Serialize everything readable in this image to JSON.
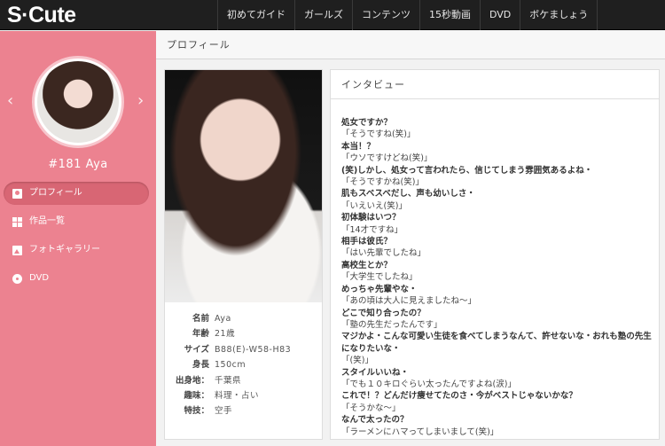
{
  "header": {
    "logo": "S·Cute",
    "nav": [
      "初めてガイド",
      "ガールズ",
      "コンテンツ",
      "15秒動画",
      "DVD",
      "ボケましょう"
    ]
  },
  "sidebar": {
    "arrow_left": "‹",
    "arrow_right": "›",
    "member_name": "#181 Aya",
    "menu": [
      {
        "label": "プロフィール",
        "icon": "profile-icon"
      },
      {
        "label": "作品一覧",
        "icon": "grid-icon"
      },
      {
        "label": "フォトギャラリー",
        "icon": "photo-icon"
      },
      {
        "label": "DVD",
        "icon": "disc-icon"
      }
    ]
  },
  "main": {
    "page_title": "プロフィール",
    "profile": {
      "rows": [
        {
          "label": "名前",
          "value": "Aya"
        },
        {
          "label": "年齢",
          "value": "21歳"
        },
        {
          "label": "サイズ",
          "value": "B88(E)-W58-H83"
        },
        {
          "label": "身長",
          "value": "150cm"
        },
        {
          "label": "出身地：",
          "value": "千葉県"
        },
        {
          "label": "趣味：",
          "value": "料理・占い"
        },
        {
          "label": "特技：",
          "value": "空手"
        }
      ]
    },
    "interview": {
      "title": "インタビュー",
      "lines": [
        {
          "q": true,
          "text": "処女ですか？"
        },
        {
          "q": false,
          "text": "「そうですね(笑)」"
        },
        {
          "q": true,
          "text": "本当！？"
        },
        {
          "q": false,
          "text": "「ウソですけどね(笑)」"
        },
        {
          "q": true,
          "text": "(笑)しかし、処女って言われたら、信じてしまう雰囲気あるよね・"
        },
        {
          "q": false,
          "text": "「そうですかね(笑)」"
        },
        {
          "q": true,
          "text": "肌もスベスベだし、声も幼いしさ・"
        },
        {
          "q": false,
          "text": "「いえいえ(笑)」"
        },
        {
          "q": true,
          "text": "初体験はいつ？"
        },
        {
          "q": false,
          "text": "「14才ですね」"
        },
        {
          "q": true,
          "text": "相手は彼氏？"
        },
        {
          "q": false,
          "text": "「はい先輩でしたね」"
        },
        {
          "q": true,
          "text": "高校生とか？"
        },
        {
          "q": false,
          "text": "「大学生でしたね」"
        },
        {
          "q": true,
          "text": "めっちゃ先輩やな・"
        },
        {
          "q": false,
          "text": "「あの頃は大人に見えましたね〜」"
        },
        {
          "q": true,
          "text": "どこで知り合ったの？"
        },
        {
          "q": false,
          "text": "「塾の先生だったんです」"
        },
        {
          "q": true,
          "wrap": true,
          "text": "マジかよ・こんな可愛い生徒を食べてしまうなんて、許せないな・おれも塾の先生になりたいな・"
        },
        {
          "q": false,
          "text": "「(笑)」"
        },
        {
          "q": true,
          "text": "スタイルいいね・"
        },
        {
          "q": false,
          "text": "「でも１０キロぐらい太ったんですよね(涙)」"
        },
        {
          "q": true,
          "text": "これで！？どんだけ痩せてたのさ・今がベストじゃないかな？"
        },
        {
          "q": false,
          "text": "「そうかな〜」"
        },
        {
          "q": true,
          "text": "なんで太ったの？"
        },
        {
          "q": false,
          "text": "「ラーメンにハマってしまいまして(笑)」"
        }
      ]
    }
  }
}
